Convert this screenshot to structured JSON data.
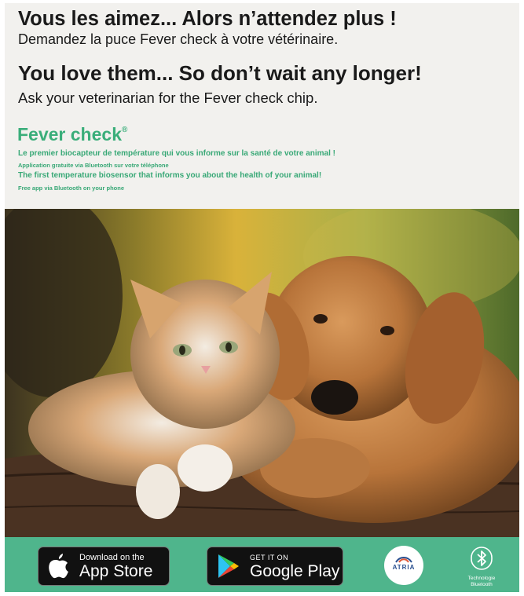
{
  "headline_fr": "Vous les aimez... Alors n’attendez plus !",
  "subline_fr": "Demandez la puce Fever check à votre vétérinaire.",
  "headline_en": "You love them... So don’t wait any longer!",
  "subline_en": "Ask your veterinarian for the Fever check chip.",
  "brand": {
    "name": "Fever check",
    "mark": "®"
  },
  "tagline": {
    "fr_main": "Le premier biocapteur de température qui vous informe sur la santé de votre animal !",
    "fr_note": "Application gratuite via Bluetooth sur votre téléphone",
    "en_main": "The first temperature biosensor that informs you about the health of your animal!",
    "en_note": "Free app via Bluetooth on your phone"
  },
  "footer": {
    "app_store": {
      "small": "Download on the",
      "big": "App Store",
      "icon": "apple-icon"
    },
    "google_play": {
      "small": "GET IT ON",
      "big": "Google Play",
      "icon": "play-icon"
    },
    "atria_logo": "ATRIA",
    "bluetooth": {
      "icon": "bluetooth-icon",
      "line1": "Technologie",
      "line2": "Bluetooth"
    }
  },
  "colors": {
    "brand_green": "#3aae7a",
    "footer_green": "#4fb58c",
    "background": "#f2f1ee",
    "text_dark": "#1a1a1a"
  }
}
